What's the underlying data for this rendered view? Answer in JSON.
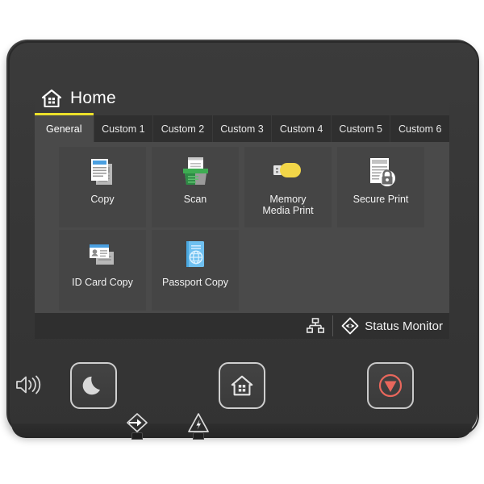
{
  "device": {
    "name": "printer-control-panel"
  },
  "screen": {
    "header": {
      "icon": "home-icon",
      "title": "Home"
    },
    "tabs": [
      {
        "label": "General",
        "active": true
      },
      {
        "label": "Custom 1",
        "active": false
      },
      {
        "label": "Custom 2",
        "active": false
      },
      {
        "label": "Custom 3",
        "active": false
      },
      {
        "label": "Custom 4",
        "active": false
      },
      {
        "label": "Custom 5",
        "active": false
      },
      {
        "label": "Custom 6",
        "active": false
      }
    ],
    "tiles": [
      {
        "label": "Copy",
        "icon": "copy-documents-icon",
        "accent": "#4a9fe0"
      },
      {
        "label": "Scan",
        "icon": "scanner-icon",
        "accent": "#3eac52"
      },
      {
        "label": "Memory\nMedia Print",
        "icon": "usb-drive-icon",
        "accent": "#f2d648"
      },
      {
        "label": "Secure Print",
        "icon": "document-lock-icon",
        "accent": "#d8d8d8"
      },
      {
        "label": "ID Card Copy",
        "icon": "id-card-icon",
        "accent": "#4a9fe0"
      },
      {
        "label": "Passport Copy",
        "icon": "passport-book-icon",
        "accent": "#6fc0f0"
      }
    ],
    "status_bar": {
      "network_icon": "network-lan-icon",
      "monitor_icon": "status-monitor-eye-icon",
      "monitor_label": "Status Monitor"
    }
  },
  "hardware": {
    "speaker_icon": "speaker-volume-icon",
    "sleep_button": {
      "icon": "crescent-moon-icon",
      "label": "Energy Saver"
    },
    "home_button": {
      "icon": "home-house-icon",
      "label": "Home"
    },
    "stop_button": {
      "icon": "stop-circle-icon",
      "label": "Stop",
      "color": "#e8675c"
    },
    "indicators": [
      {
        "icon": "data-in-arrow-icon",
        "label": "Data In"
      },
      {
        "icon": "error-warning-icon",
        "label": "Error"
      }
    ]
  },
  "colors": {
    "screen_bg": "#3a3a3a",
    "tile_area_bg": "#4a4a4a",
    "tile_bg": "#454545",
    "tab_active_bg": "#4a4a4a",
    "tab_inactive_bg": "#2f2f2f",
    "accent_yellow": "#ece02a",
    "status_bar_bg": "#2f2f2f",
    "stop_red": "#e8675c"
  }
}
